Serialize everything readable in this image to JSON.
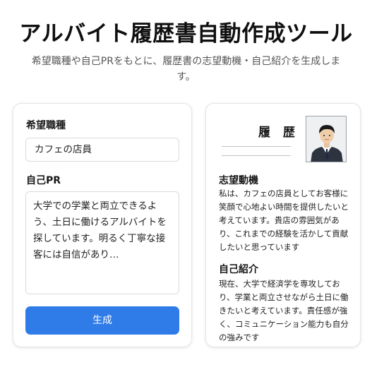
{
  "header": {
    "title": "アルバイト履歴書自動作成ツール",
    "subtitle": "希望職種や自己PRをもとに、履歴書の志望動機・自己紹介を生成します。"
  },
  "form": {
    "job_label": "希望職種",
    "job_value": "カフェの店員",
    "pr_label": "自己PR",
    "pr_value": "大学での学業と両立できるよう、土日に働けるアルバイトを探しています。明るく丁寧な接客には自信があり…",
    "generate_label": "生成"
  },
  "preview": {
    "doc_title": "履 歴",
    "motivation_title": "志望動機",
    "motivation_text": "私は、カフェの店員としてお客様に笑顔で心地よい時間を提供したいと考えています。貴店の雰囲気があり、これまでの経験を活かして貢献したいと思っています",
    "intro_title": "自己紹介",
    "intro_text": "現在、大学で経済学を専攻しており、学業と両立させながら土日に働きたいと考えています。責任感が強く、コミュニケーション能力も自分の強みです"
  },
  "colors": {
    "accent": "#2f7be8",
    "border": "#e3e5e8"
  },
  "icons": {
    "photo": "applicant-photo-icon"
  }
}
